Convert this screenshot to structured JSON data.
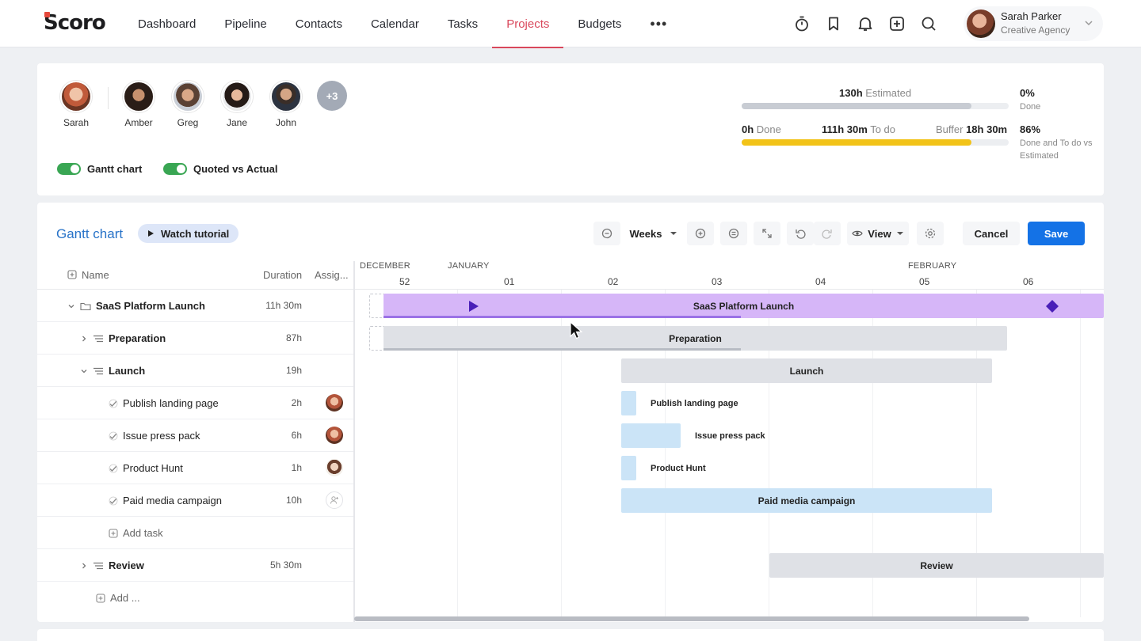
{
  "app": {
    "logo_text": "Scoro"
  },
  "nav": {
    "items": [
      "Dashboard",
      "Pipeline",
      "Contacts",
      "Calendar",
      "Tasks",
      "Projects",
      "Budgets"
    ],
    "active": "Projects",
    "more": "•••"
  },
  "user": {
    "name": "Sarah Parker",
    "company": "Creative Agency"
  },
  "team": {
    "members": [
      "Sarah",
      "Amber",
      "Greg",
      "Jane",
      "John"
    ],
    "more_label": "+3"
  },
  "toggles": {
    "gantt": "Gantt chart",
    "quoted": "Quoted vs Actual"
  },
  "stats": {
    "estimated_value": "130h",
    "estimated_label": "Estimated",
    "done_pct": "0%",
    "done_label": "Done",
    "done_value": "0h",
    "done_word": "Done",
    "todo_value": "111h 30m",
    "todo_label": "To do",
    "buffer_label": "Buffer",
    "buffer_value": "18h 30m",
    "done_todo_pct": "86%",
    "done_todo_label": "Done and To do vs Estimated",
    "estimated_progress": 0.86,
    "done_todo_progress": 0.86,
    "colors": {
      "bar_grey": "#c8ccd3",
      "bar_yellow": "#f2c318"
    }
  },
  "gantt": {
    "title": "Gantt chart",
    "watch_label": "Watch tutorial",
    "scale": "Weeks",
    "view_label": "View",
    "cancel": "Cancel",
    "save": "Save",
    "col_name": "Name",
    "col_duration": "Duration",
    "col_assignee": "Assig...",
    "months": [
      "DECEMBER",
      "JANUARY",
      "FEBRUARY"
    ],
    "weeks": [
      "52",
      "01",
      "02",
      "03",
      "04",
      "05",
      "06"
    ],
    "rows": [
      {
        "name": "SaaS Platform Launch",
        "duration": "11h 30m"
      },
      {
        "name": "Preparation",
        "duration": "87h"
      },
      {
        "name": "Launch",
        "duration": "19h"
      },
      {
        "name": "Publish landing page",
        "duration": "2h"
      },
      {
        "name": "Issue press pack",
        "duration": "6h"
      },
      {
        "name": "Product Hunt",
        "duration": "1h"
      },
      {
        "name": "Paid media campaign",
        "duration": "10h"
      },
      {
        "name": "Add task",
        "duration": ""
      },
      {
        "name": "Review",
        "duration": "5h 30m"
      },
      {
        "name": "Add ...",
        "duration": ""
      }
    ],
    "bars": {
      "saas": "SaaS Platform Launch",
      "prep": "Preparation",
      "launch": "Launch",
      "publish": "Publish landing page",
      "press": "Issue press pack",
      "ph": "Product Hunt",
      "paid": "Paid media campaign",
      "review": "Review"
    },
    "colors": {
      "project_bar": "#d6b6f8",
      "milestone": "#4a1fb8",
      "task_bar": "#cbe4f7",
      "phase_bar": "#dfe1e6",
      "save": "#1472e6"
    }
  }
}
